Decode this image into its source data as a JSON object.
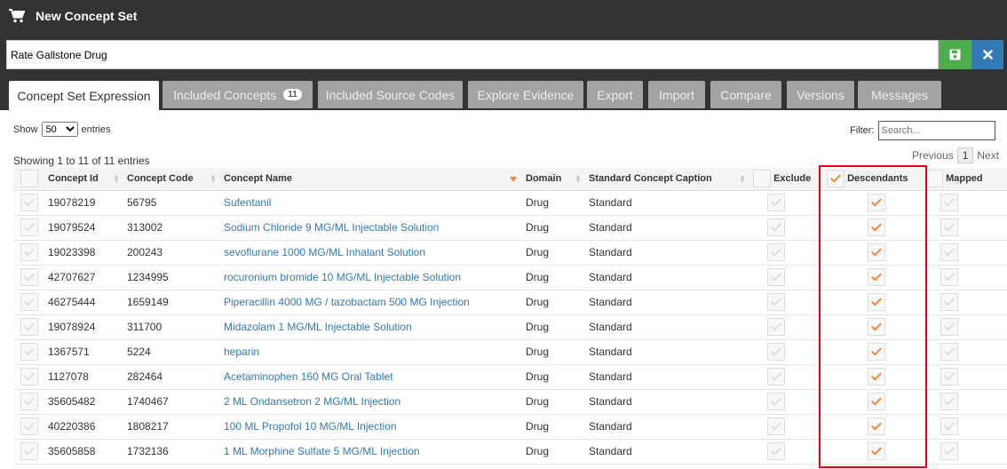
{
  "header": {
    "title": "New Concept Set",
    "icon": "cart-icon",
    "name_value": "Rate Gallstone Drug"
  },
  "colors": {
    "header_bg": "#333333",
    "save_green": "#4cae4c",
    "close_blue": "#337ab7",
    "checked_orange": "#f0883e",
    "highlight_red": "#e3001b",
    "link_blue": "#337ab7"
  },
  "tabs": [
    {
      "label": "Concept Set Expression",
      "active": true
    },
    {
      "label": "Included Concepts",
      "badge": "11"
    },
    {
      "label": "Included Source Codes"
    },
    {
      "label": "Explore Evidence"
    },
    {
      "label": "Export"
    },
    {
      "label": "Import"
    },
    {
      "label": "Compare"
    },
    {
      "label": "Versions"
    },
    {
      "label": "Messages"
    }
  ],
  "controls": {
    "show_label": "Show",
    "page_size": "50",
    "entries_label": "entries",
    "filter_label": "Filter:",
    "filter_placeholder": "Search...",
    "showing_text": "Showing 1 to 11 of 11 entries",
    "previous": "Previous",
    "page": "1",
    "next": "Next"
  },
  "table": {
    "columns": [
      "Concept Id",
      "Concept Code",
      "Concept Name",
      "Domain",
      "Standard Concept Caption",
      "Exclude",
      "Descendants",
      "Mapped"
    ],
    "header_checks": {
      "select_all": false,
      "exclude": false,
      "descendants": true,
      "mapped": false
    },
    "rows": [
      {
        "id": "19078219",
        "code": "56795",
        "name": "Sufentanil",
        "domain": "Drug",
        "standard": "Standard",
        "exclude": false,
        "descendants": true,
        "mapped": false
      },
      {
        "id": "19079524",
        "code": "313002",
        "name": "Sodium Chloride 9 MG/ML Injectable Solution",
        "domain": "Drug",
        "standard": "Standard",
        "exclude": false,
        "descendants": true,
        "mapped": false
      },
      {
        "id": "19023398",
        "code": "200243",
        "name": "sevoflurane 1000 MG/ML Inhalant Solution",
        "domain": "Drug",
        "standard": "Standard",
        "exclude": false,
        "descendants": true,
        "mapped": false
      },
      {
        "id": "42707627",
        "code": "1234995",
        "name": "rocuronium bromide 10 MG/ML Injectable Solution",
        "domain": "Drug",
        "standard": "Standard",
        "exclude": false,
        "descendants": true,
        "mapped": false
      },
      {
        "id": "46275444",
        "code": "1659149",
        "name": "Piperacillin 4000 MG / tazobactam 500 MG Injection",
        "domain": "Drug",
        "standard": "Standard",
        "exclude": false,
        "descendants": true,
        "mapped": false
      },
      {
        "id": "19078924",
        "code": "311700",
        "name": "Midazolam 1 MG/ML Injectable Solution",
        "domain": "Drug",
        "standard": "Standard",
        "exclude": false,
        "descendants": true,
        "mapped": false
      },
      {
        "id": "1367571",
        "code": "5224",
        "name": "heparin",
        "domain": "Drug",
        "standard": "Standard",
        "exclude": false,
        "descendants": true,
        "mapped": false
      },
      {
        "id": "1127078",
        "code": "282464",
        "name": "Acetaminophen 160 MG Oral Tablet",
        "domain": "Drug",
        "standard": "Standard",
        "exclude": false,
        "descendants": true,
        "mapped": false
      },
      {
        "id": "35605482",
        "code": "1740467",
        "name": "2 ML Ondansetron 2 MG/ML Injection",
        "domain": "Drug",
        "standard": "Standard",
        "exclude": false,
        "descendants": true,
        "mapped": false
      },
      {
        "id": "40220386",
        "code": "1808217",
        "name": "100 ML Propofol 10 MG/ML Injection",
        "domain": "Drug",
        "standard": "Standard",
        "exclude": false,
        "descendants": true,
        "mapped": false
      },
      {
        "id": "35605858",
        "code": "1732136",
        "name": "1 ML Morphine Sulfate 5 MG/ML Injection",
        "domain": "Drug",
        "standard": "Standard",
        "exclude": false,
        "descendants": true,
        "mapped": false
      }
    ]
  }
}
